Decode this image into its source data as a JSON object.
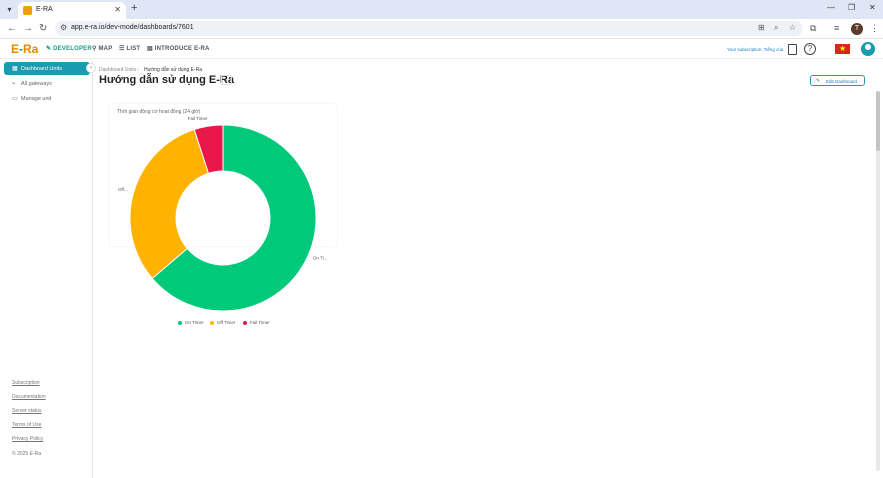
{
  "browser": {
    "tab_title": "E-RA",
    "url": "app.e-ra.io/dev-mode/dashboards/7601",
    "profile_initial": "T"
  },
  "app": {
    "logo": {
      "part1": "E",
      "part2": "-",
      "part3": "Ra"
    },
    "nav": [
      "DEVELOPER",
      "MAP",
      "LIST",
      "INTRODUCE E-RA"
    ],
    "subscription_text": "Your subscription: Tiếng của",
    "colors": {
      "accent": "#1a9bb0",
      "brand": "#e08a00"
    }
  },
  "sidebar": {
    "items": [
      {
        "label": "Dashboard Units",
        "icon": "grid-icon"
      },
      {
        "label": "All gateways",
        "icon": "wifi-icon"
      },
      {
        "label": "Manage unit",
        "icon": "folder-icon"
      }
    ],
    "footer": [
      "Subscription",
      "Documentation",
      "Server status",
      "Terms of Use",
      "Privacy Policy"
    ],
    "copyright": "© 2025 E-Ra"
  },
  "main": {
    "breadcrumb": [
      "Dashboard Units",
      "Hướng dẫn sử dụng E-Ra"
    ],
    "title": "Hướng dẫn sử dụng E-Ra",
    "edit_button": "Edit Dashboard",
    "widget_title": "Thời gian động cơ hoạt động (24 giờ)"
  },
  "chart_data": {
    "type": "pie",
    "title": "Thời gian động cơ hoạt động (24 giờ)",
    "series": [
      {
        "name": "On Timer",
        "value": 15.3,
        "label": "On Ti...",
        "color": "#00c97a"
      },
      {
        "name": "Off Timer",
        "value": 7.5,
        "label": "Off...",
        "color": "#ffb300"
      },
      {
        "name": "Fail Timer",
        "value": 1.2,
        "label": "Fail Timer",
        "color": "#e8174c"
      }
    ],
    "legend_position": "bottom"
  }
}
